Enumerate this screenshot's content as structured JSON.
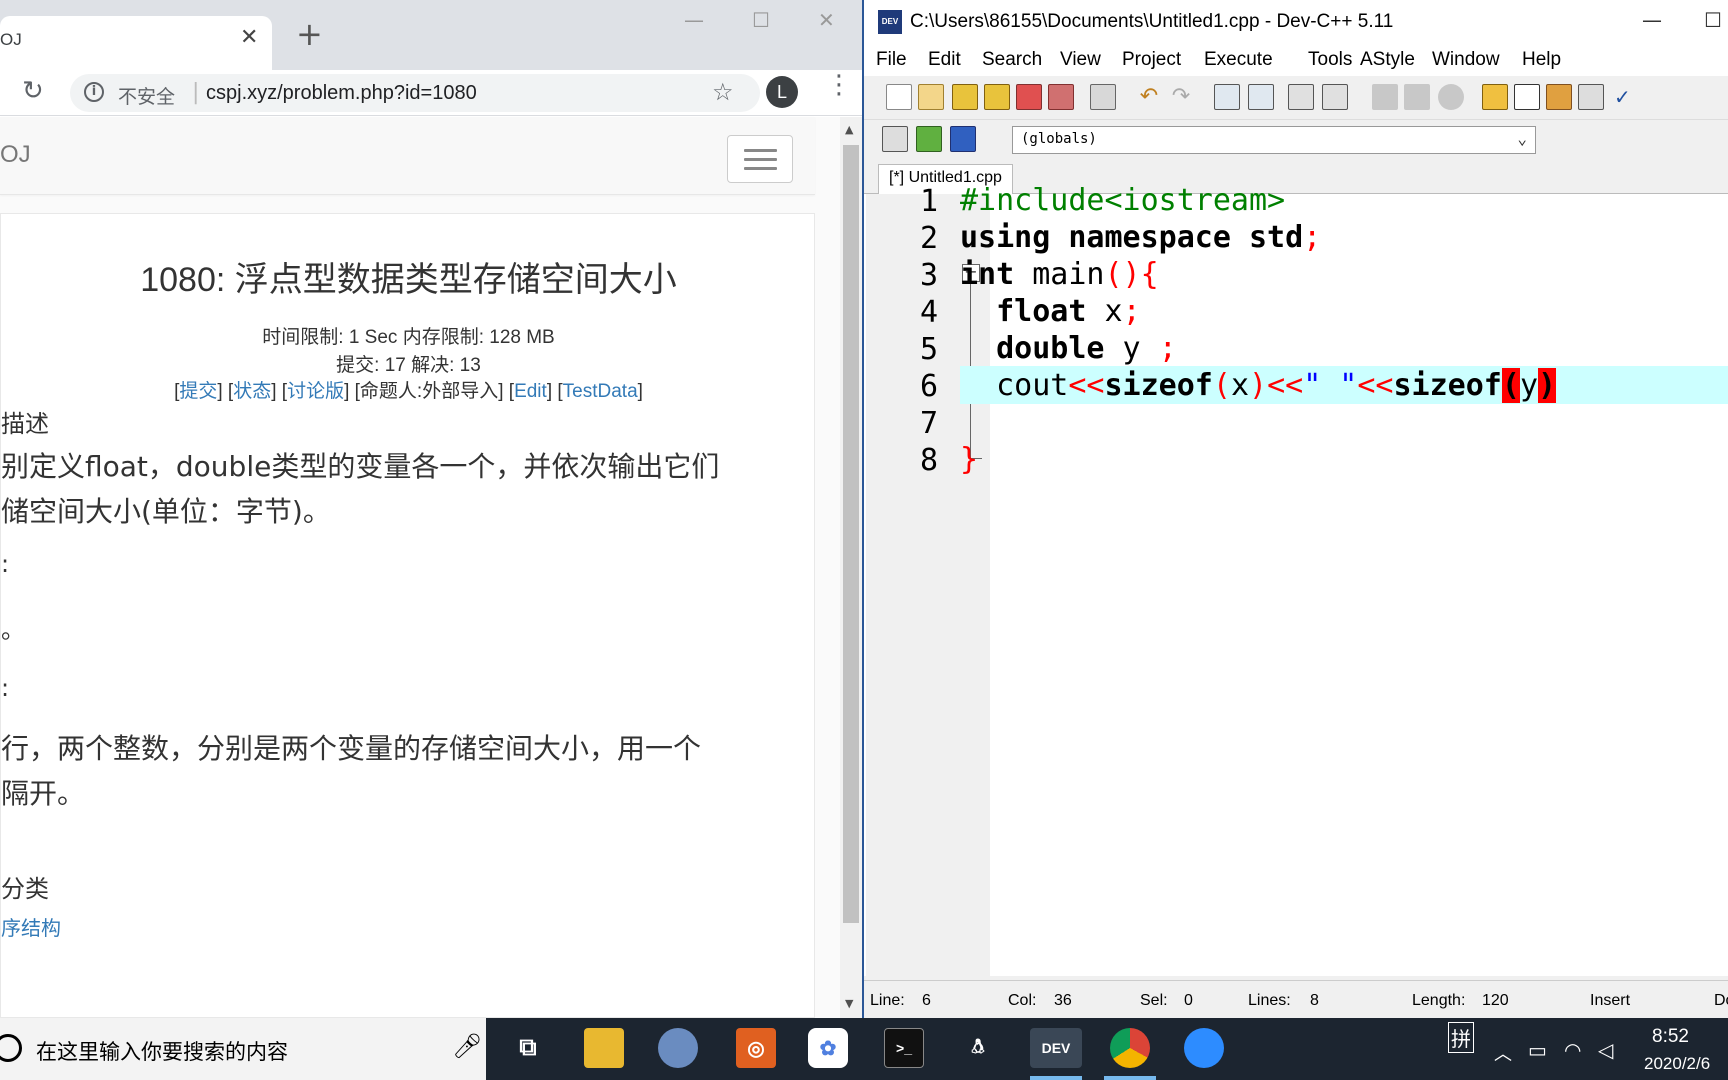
{
  "browser": {
    "tab_title": "OJ",
    "new_tab_symbol": "+",
    "insecure_label": "不安全",
    "url": "cspj.xyz/problem.php?id=1080",
    "avatar_letter": "L",
    "brand": "OJ",
    "problem": {
      "title": "1080: 浮点型数据类型存储空间大小",
      "limits": "时间限制: 1 Sec  内存限制: 128 MB",
      "stats": "提交: 17  解决: 13",
      "links": {
        "submit": "提交",
        "status": "状态",
        "discuss": "讨论版",
        "author": "[命题人:外部导入]",
        "edit": "Edit",
        "testdata": "TestData"
      },
      "description_heading": "描述",
      "description_line1": "别定义float，double类型的变量各一个，并依次输出它们",
      "description_line2": "储空间大小(单位：字节)。",
      "input_heading": ":",
      "input_text": "。",
      "output_heading": ":",
      "output_line1": "行，两个整数，分别是两个变量的存储空间大小，用一个",
      "output_line2": "隔开。",
      "category_heading": "分类",
      "category_link": "序结构"
    }
  },
  "devcpp": {
    "title": "C:\\Users\\86155\\Documents\\Untitled1.cpp - Dev-C++ 5.11",
    "icon_text": "DEV",
    "menu": [
      "File",
      "Edit",
      "Search",
      "View",
      "Project",
      "Execute",
      "Tools",
      "AStyle",
      "Window",
      "Help"
    ],
    "scope_combo": "(globals)",
    "file_tab": "[*] Untitled1.cpp",
    "line_numbers": [
      "1",
      "2",
      "3",
      "4",
      "5",
      "6",
      "7",
      "8"
    ],
    "code": {
      "l1_pp": "#include<iostream>",
      "l2_a": "using namespace std",
      "l2_semi": ";",
      "l3_a": "int",
      "l3_b": " main",
      "l3_sym": "(){",
      "l4_kw": "float",
      "l4_id": " x",
      "l4_semi": ";",
      "l5_kw": "double",
      "l5_id": " y ",
      "l5_semi": ";",
      "l6_cout": "cout",
      "l6_op1": "<<",
      "l6_sizeof1": "sizeof",
      "l6_p1o": "(",
      "l6_x": "x",
      "l6_p1c": ")",
      "l6_op2": "<<",
      "l6_str": "\" \"",
      "l6_op3": "<<",
      "l6_sizeof2": "sizeof",
      "l6_p2o": "(",
      "l6_y": "y",
      "l6_p2c": ")",
      "l8_brace": "}"
    },
    "status": {
      "line_label": "Line:",
      "line_value": "6",
      "col_label": "Col:",
      "col_value": "36",
      "sel_label": "Sel:",
      "sel_value": "0",
      "lines_label": "Lines:",
      "lines_value": "8",
      "length_label": "Length:",
      "length_value": "120",
      "mode": "Insert",
      "extra": "Do"
    }
  },
  "taskbar": {
    "search_placeholder": "在这里输入你要搜索的内容",
    "ime": "拼",
    "time": "8:52",
    "date": "2020/2/6",
    "dev_label": "DEV"
  },
  "colors": {
    "keyword_red": "#ff0000",
    "preprocessor_green": "#008000",
    "string_blue": "#0000ff",
    "active_line": "#ccffff",
    "link_blue": "#337ab7",
    "taskbar_bg": "#1c2530"
  }
}
